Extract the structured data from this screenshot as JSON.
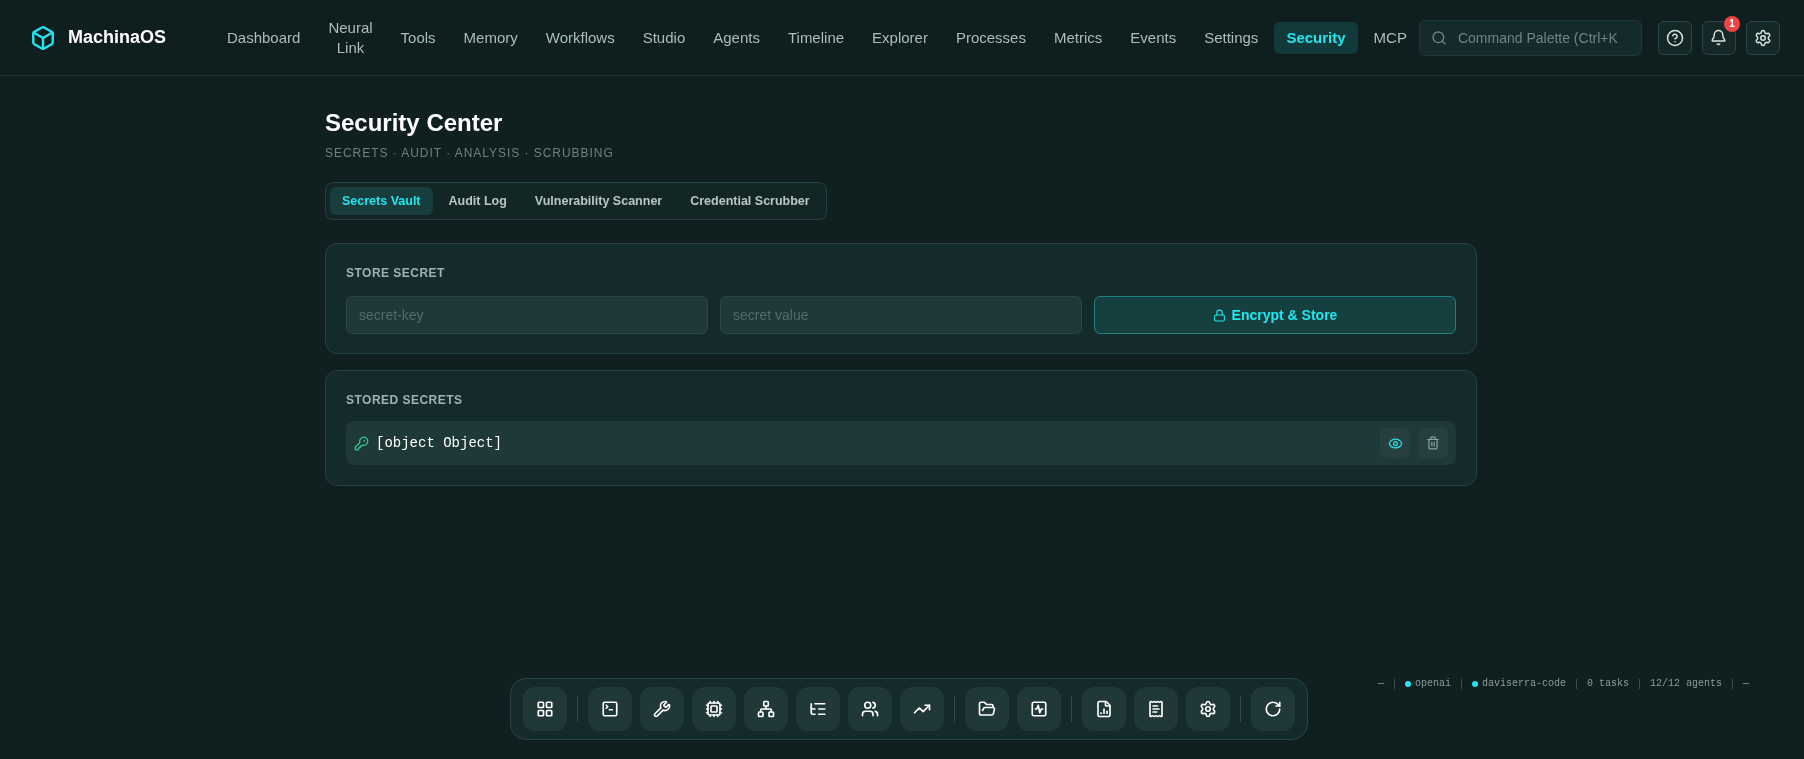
{
  "brand": {
    "name": "MachinaOS"
  },
  "nav": [
    {
      "label": "Dashboard",
      "selected": false
    },
    {
      "label": "Neural Link",
      "selected": false
    },
    {
      "label": "Tools",
      "selected": false
    },
    {
      "label": "Memory",
      "selected": false
    },
    {
      "label": "Workflows",
      "selected": false
    },
    {
      "label": "Studio",
      "selected": false
    },
    {
      "label": "Agents",
      "selected": false
    },
    {
      "label": "Timeline",
      "selected": false
    },
    {
      "label": "Explorer",
      "selected": false
    },
    {
      "label": "Processes",
      "selected": false
    },
    {
      "label": "Metrics",
      "selected": false
    },
    {
      "label": "Events",
      "selected": false
    },
    {
      "label": "Settings",
      "selected": false
    },
    {
      "label": "Security",
      "selected": true
    },
    {
      "label": "MCP",
      "selected": false
    }
  ],
  "search": {
    "placeholder": "Command Palette (Ctrl+K"
  },
  "notifications": {
    "count": "1"
  },
  "page": {
    "title": "Security Center",
    "subtitle": "SECRETS · AUDIT · ANALYSIS · SCRUBBING"
  },
  "tabs": [
    {
      "label": "Secrets Vault",
      "selected": true
    },
    {
      "label": "Audit Log",
      "selected": false
    },
    {
      "label": "Vulnerability Scanner",
      "selected": false
    },
    {
      "label": "Credential Scrubber",
      "selected": false
    }
  ],
  "store_secret": {
    "heading": "STORE SECRET",
    "key_placeholder": "secret-key",
    "value_placeholder": "secret value",
    "button": "Encrypt & Store"
  },
  "stored_secrets": {
    "heading": "STORED SECRETS",
    "items": [
      {
        "name": "[object Object]"
      }
    ]
  },
  "status_bar": [
    {
      "text": "—"
    },
    {
      "text": "openai",
      "color": "#22e5ee"
    },
    {
      "text": "daviserra-code",
      "color": "#22e5ee"
    },
    {
      "text": "0 tasks"
    },
    {
      "text": "12/12 agents"
    },
    {
      "text": "—"
    }
  ]
}
